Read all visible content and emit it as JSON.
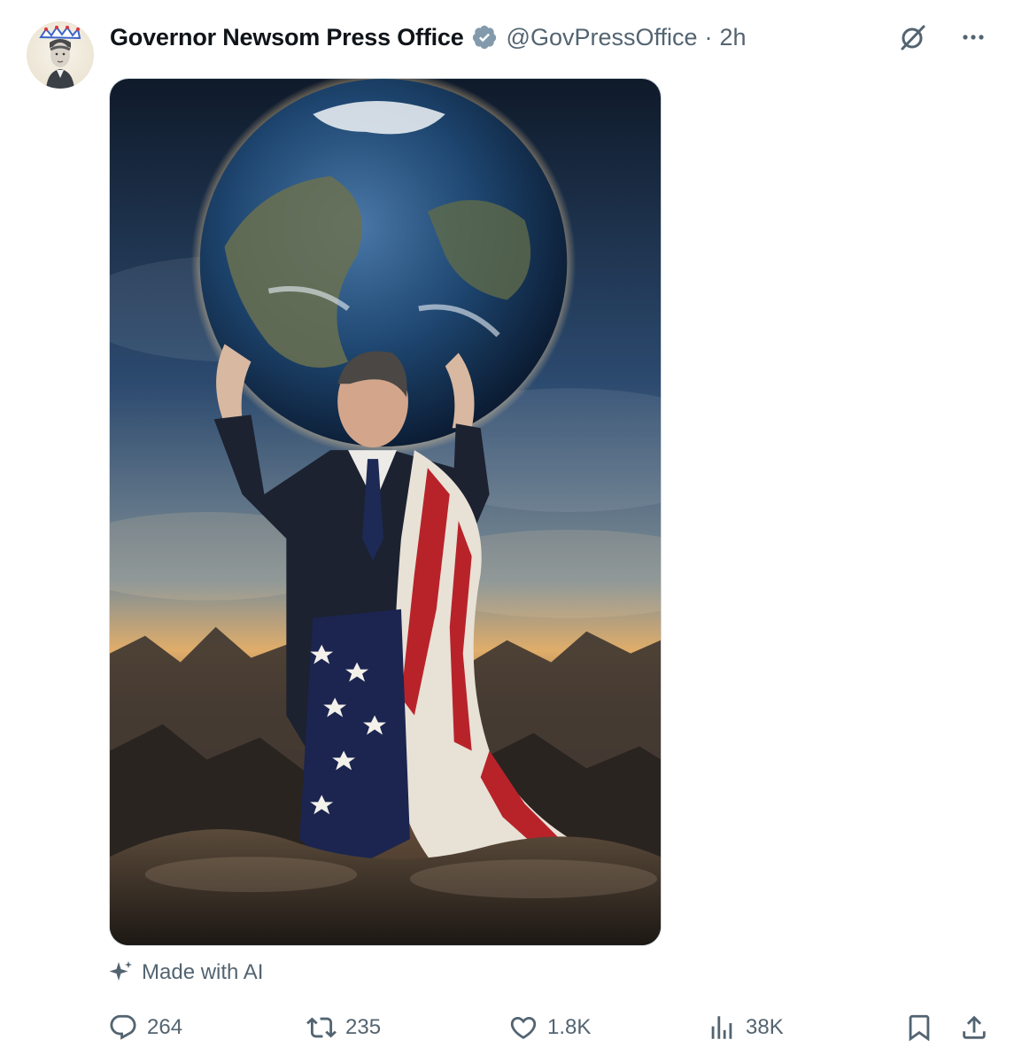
{
  "post": {
    "author": {
      "display_name": "Governor Newsom Press Office",
      "handle": "@GovPressOffice",
      "verified": true
    },
    "separator": "·",
    "time": "2h",
    "media": {
      "kind": "image"
    },
    "ai_label": "Made with AI",
    "stats": {
      "replies": "264",
      "reposts": "235",
      "likes": "1.8K",
      "views": "38K"
    }
  },
  "icons": {
    "verified": "verified-badge-icon",
    "grok": "grok-icon",
    "more": "more-options-icon",
    "sparkle": "ai-sparkle-icon",
    "reply": "reply-icon",
    "repost": "repost-icon",
    "like": "like-icon",
    "views": "views-icon",
    "bookmark": "bookmark-icon",
    "share": "share-icon"
  },
  "colors": {
    "text_primary": "#0f1419",
    "text_secondary": "#536471",
    "verified": "#829aab",
    "border": "#cfd9de"
  }
}
